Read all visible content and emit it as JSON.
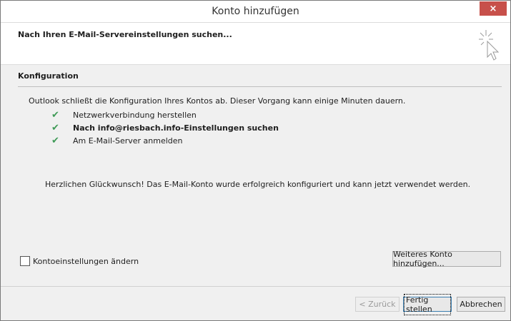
{
  "window": {
    "title": "Konto hinzufügen",
    "close_label": "×"
  },
  "header": {
    "title": "Nach Ihren E-Mail-Servereinstellungen suchen...",
    "icon": "cursor-sparkle-icon"
  },
  "configuration": {
    "section_title": "Konfiguration",
    "description": "Outlook schließt die Konfiguration Ihres Kontos ab. Dieser Vorgang kann einige Minuten dauern.",
    "steps": [
      {
        "label": "Netzwerkverbindung herstellen",
        "status": "done"
      },
      {
        "label": "Nach info@riesbach.info-Einstellungen suchen",
        "status": "done"
      },
      {
        "label": "Am E-Mail-Server anmelden",
        "status": "done"
      }
    ],
    "success_message": "Herzlichen Glückwunsch! Das E-Mail-Konto wurde erfolgreich konfiguriert und kann jetzt verwendet werden."
  },
  "options": {
    "change_settings_label": "Kontoeinstellungen ändern",
    "change_settings_checked": false,
    "add_another_label": "Weiteres Konto hinzufügen..."
  },
  "footer": {
    "back_label": "< Zurück",
    "finish_label": "Fertig stellen",
    "cancel_label": "Abbrechen"
  },
  "colors": {
    "check": "#3e9a56",
    "close": "#c7504a"
  }
}
